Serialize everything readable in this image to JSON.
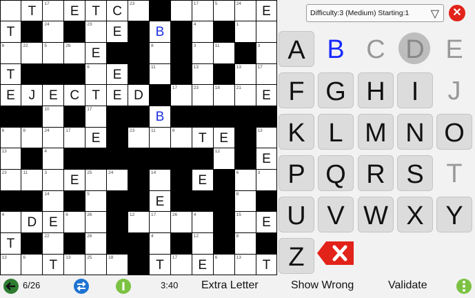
{
  "difficulty": {
    "label": "Difficulty:3  (Medium) Starting:1"
  },
  "close_icon": "x-icon",
  "keys": [
    {
      "char": "A",
      "state": "active"
    },
    {
      "char": "B",
      "state": "blue"
    },
    {
      "char": "C",
      "state": "grey"
    },
    {
      "char": "D",
      "state": "circle"
    },
    {
      "char": "E",
      "state": "grey"
    },
    {
      "char": "F",
      "state": "active"
    },
    {
      "char": "G",
      "state": "active"
    },
    {
      "char": "H",
      "state": "active"
    },
    {
      "char": "I",
      "state": "active"
    },
    {
      "char": "J",
      "state": "grey"
    },
    {
      "char": "K",
      "state": "active"
    },
    {
      "char": "L",
      "state": "active"
    },
    {
      "char": "M",
      "state": "active"
    },
    {
      "char": "N",
      "state": "active"
    },
    {
      "char": "O",
      "state": "active"
    },
    {
      "char": "P",
      "state": "active"
    },
    {
      "char": "Q",
      "state": "active"
    },
    {
      "char": "R",
      "state": "active"
    },
    {
      "char": "S",
      "state": "active"
    },
    {
      "char": "T",
      "state": "grey"
    },
    {
      "char": "U",
      "state": "active"
    },
    {
      "char": "V",
      "state": "active"
    },
    {
      "char": "W",
      "state": "active"
    },
    {
      "char": "X",
      "state": "active"
    },
    {
      "char": "Y",
      "state": "active"
    },
    {
      "char": "Z",
      "state": "active"
    }
  ],
  "bottom": {
    "progress": "6/26",
    "timer": "3:40",
    "extra_letter": "Extra Letter",
    "show_wrong": "Show Wrong",
    "validate": "Validate"
  },
  "grid": {
    "rows": 13,
    "cols": 13,
    "cells": [
      [
        "",
        "T",
        "17",
        "E",
        "T",
        "C",
        "23",
        "#",
        "",
        "17",
        "5",
        "24",
        "E"
      ],
      [
        "T",
        "#",
        "24",
        "#",
        "23",
        "E",
        "#",
        "B",
        "#",
        "4",
        "#",
        "1",
        ""
      ],
      [
        "6",
        "22",
        "5",
        "26",
        "E",
        "#",
        "#",
        "8",
        "#",
        "3",
        "11",
        "#",
        "3"
      ],
      [
        "T",
        "#",
        "#",
        "#",
        "6",
        "E",
        "#",
        "11",
        "#",
        "13",
        "#",
        "13",
        "17"
      ],
      [
        "E",
        "J",
        "E",
        "C",
        "T",
        "E",
        "D",
        "#",
        "17",
        "23",
        "18",
        "21",
        "E"
      ],
      [
        "#",
        "#",
        "10",
        "#",
        "17",
        "#",
        "#",
        "B",
        "#",
        "#",
        "#",
        "#",
        "#"
      ],
      [
        "6",
        "8",
        "24",
        "17",
        "E",
        "#",
        "23",
        "11",
        "6",
        "T",
        "E",
        "#",
        "13"
      ],
      [
        "13",
        "#",
        "4",
        "#",
        "#",
        "#",
        "#",
        "#",
        "#",
        "#",
        "12",
        "#",
        "E"
      ],
      [
        "23",
        "11",
        "3",
        "E",
        "25",
        "24",
        "#",
        "14",
        "#",
        "E",
        "#",
        "6",
        "3"
      ],
      [
        "#",
        "#",
        "14",
        "#",
        "5",
        "#",
        "#",
        "E",
        "#",
        "#",
        "#",
        "8",
        "#"
      ],
      [
        "4",
        "D",
        "E",
        "6",
        "26",
        "#",
        "12",
        "17",
        "26",
        "4",
        "#",
        "15",
        "E"
      ],
      [
        "T",
        "#",
        "22",
        "#",
        "26",
        "#",
        "#",
        "4",
        "#",
        "12",
        "#",
        "8",
        "#"
      ],
      [
        "13",
        "6",
        "T",
        "13",
        "25",
        "18",
        "#",
        "T",
        "17",
        "E",
        "6",
        "13",
        "T"
      ]
    ],
    "blue_letters": [
      "1,7",
      "5,7"
    ]
  }
}
